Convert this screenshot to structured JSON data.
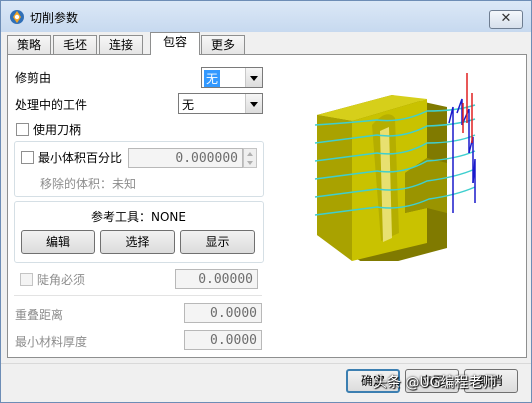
{
  "window": {
    "title": "切削参数",
    "close_label": "✕"
  },
  "tabs": [
    {
      "label": "策略"
    },
    {
      "label": "毛坯"
    },
    {
      "label": "连接"
    },
    {
      "label": "包容"
    },
    {
      "label": "更多"
    }
  ],
  "active_tab": "包容",
  "trim_by": {
    "label": "修剪由",
    "value": "无"
  },
  "in_process_workpiece": {
    "label": "处理中的工件",
    "value": "无"
  },
  "use_tool_holder": {
    "label": "使用刀柄",
    "checked": false
  },
  "min_volume": {
    "label": "最小体积百分比",
    "checked": false,
    "value": "0.000000",
    "removed_label": "移除的体积：未知"
  },
  "reference_tool": {
    "label": "参考工具：NONE",
    "buttons": {
      "edit": "编辑",
      "select": "选择",
      "display": "显示"
    }
  },
  "steep_required": {
    "label": "陡角必须",
    "checked": false,
    "value": "0.00000"
  },
  "overlap_distance": {
    "label": "重叠距离",
    "value": "0.0000"
  },
  "min_material_thickness": {
    "label": "最小材料厚度",
    "value": "0.0000"
  },
  "footer": {
    "ok_label": "确定",
    "apply_label": "应用",
    "cancel_label": "取消"
  },
  "watermark": "头条 @UG编程老师",
  "colors": {
    "part": "#c9c200",
    "toolpath": "#3fcfcf",
    "engage": "#1a1acc",
    "retract": "#e02020"
  }
}
